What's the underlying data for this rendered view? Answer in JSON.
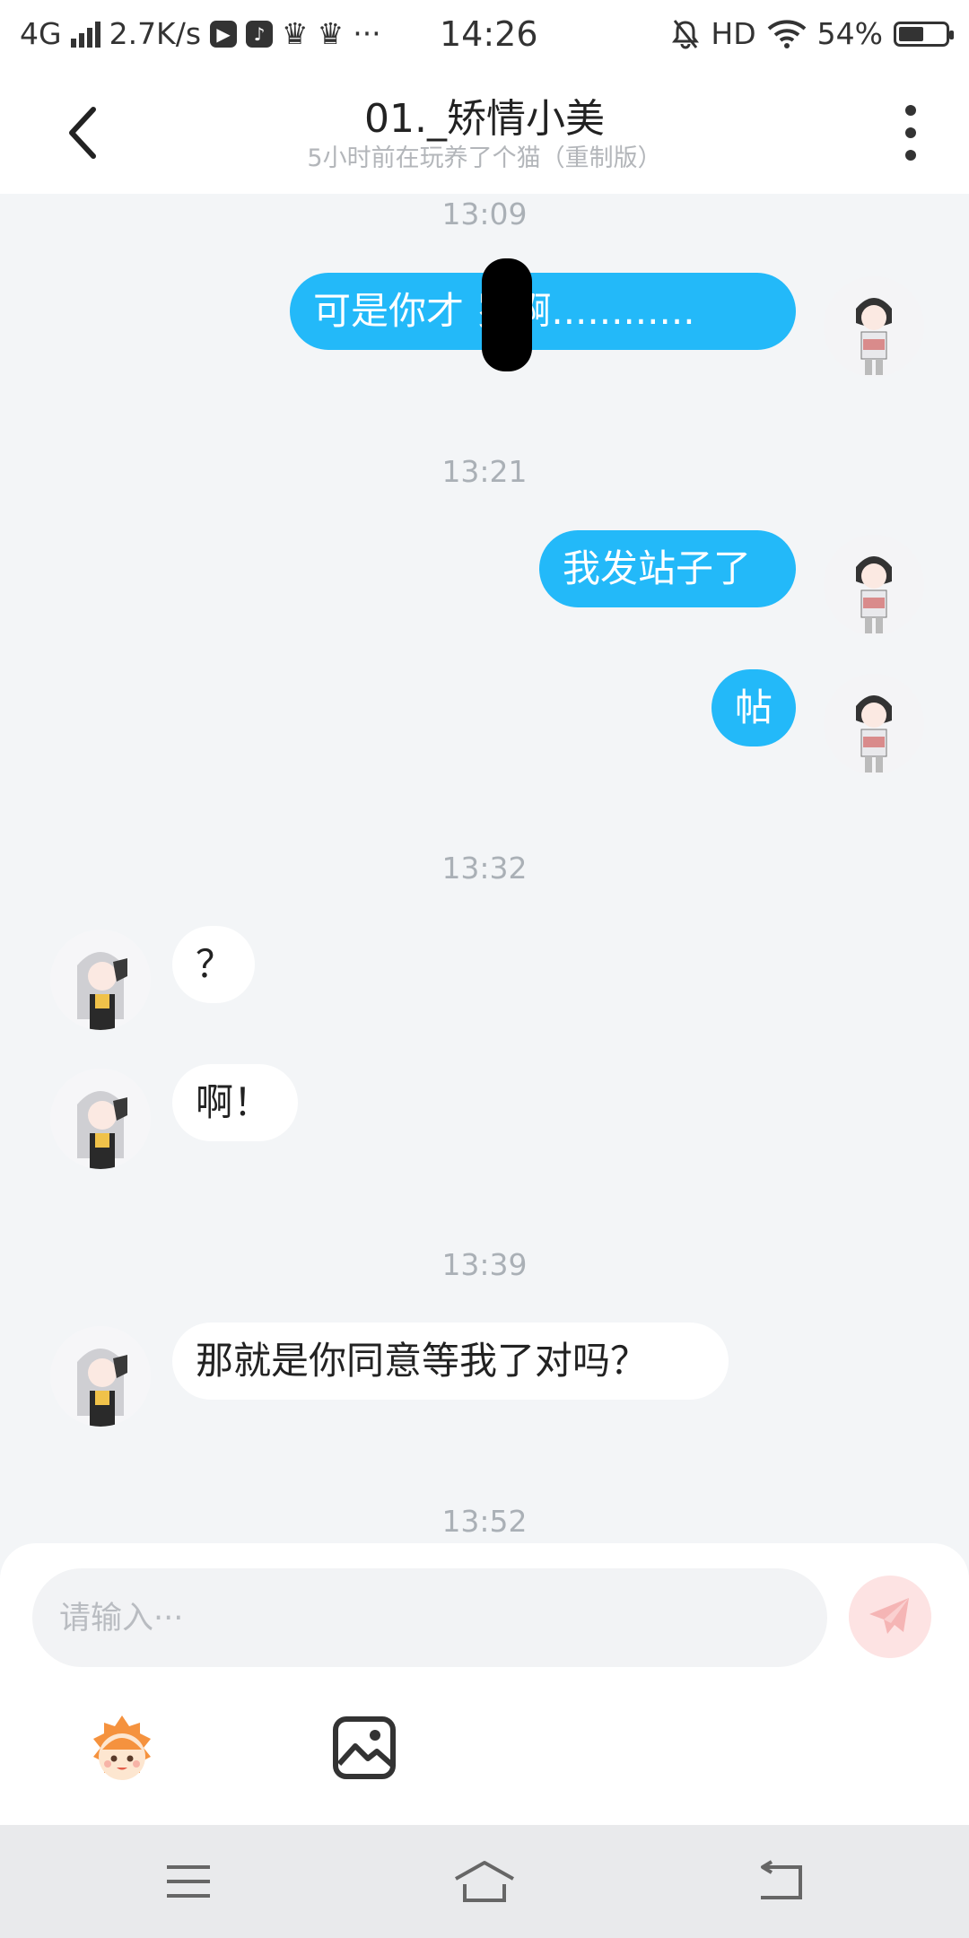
{
  "status_bar": {
    "network": "4G",
    "speed": "2.7K/s",
    "time": "14:26",
    "hd": "HD",
    "battery_text": "54%",
    "battery_level": 0.54,
    "more": "···"
  },
  "header": {
    "title": "01._矫情小美",
    "subtitle": "5小时前在玩养了个猫（重制版）"
  },
  "messages": [
    {
      "timestamp": "13:09",
      "direction": "out",
      "text": "可是你才 岁啊............"
    },
    {
      "timestamp": "13:21",
      "direction": "out",
      "text": "我发站子了"
    },
    {
      "direction": "out",
      "text": "帖"
    },
    {
      "timestamp": "13:32",
      "direction": "in",
      "text": "？"
    },
    {
      "direction": "in",
      "text": "啊！"
    },
    {
      "timestamp": "13:39",
      "direction": "in",
      "text": "那就是你同意等我了对吗？"
    },
    {
      "timestamp": "13:52"
    }
  ],
  "input": {
    "placeholder": "请输入···",
    "value": ""
  },
  "colors": {
    "outgoing_bubble": "#23b9f9",
    "incoming_bubble": "#ffffff",
    "send_button": "#fde3e3",
    "background": "#f3f5f7"
  },
  "icons": {
    "back": "chevron-left-icon",
    "more": "more-vertical-icon",
    "send": "paper-plane-icon",
    "emoji": "emoji-face-icon",
    "image": "image-icon",
    "nav_menu": "menu-icon",
    "nav_home": "home-icon",
    "nav_back": "back-icon"
  }
}
